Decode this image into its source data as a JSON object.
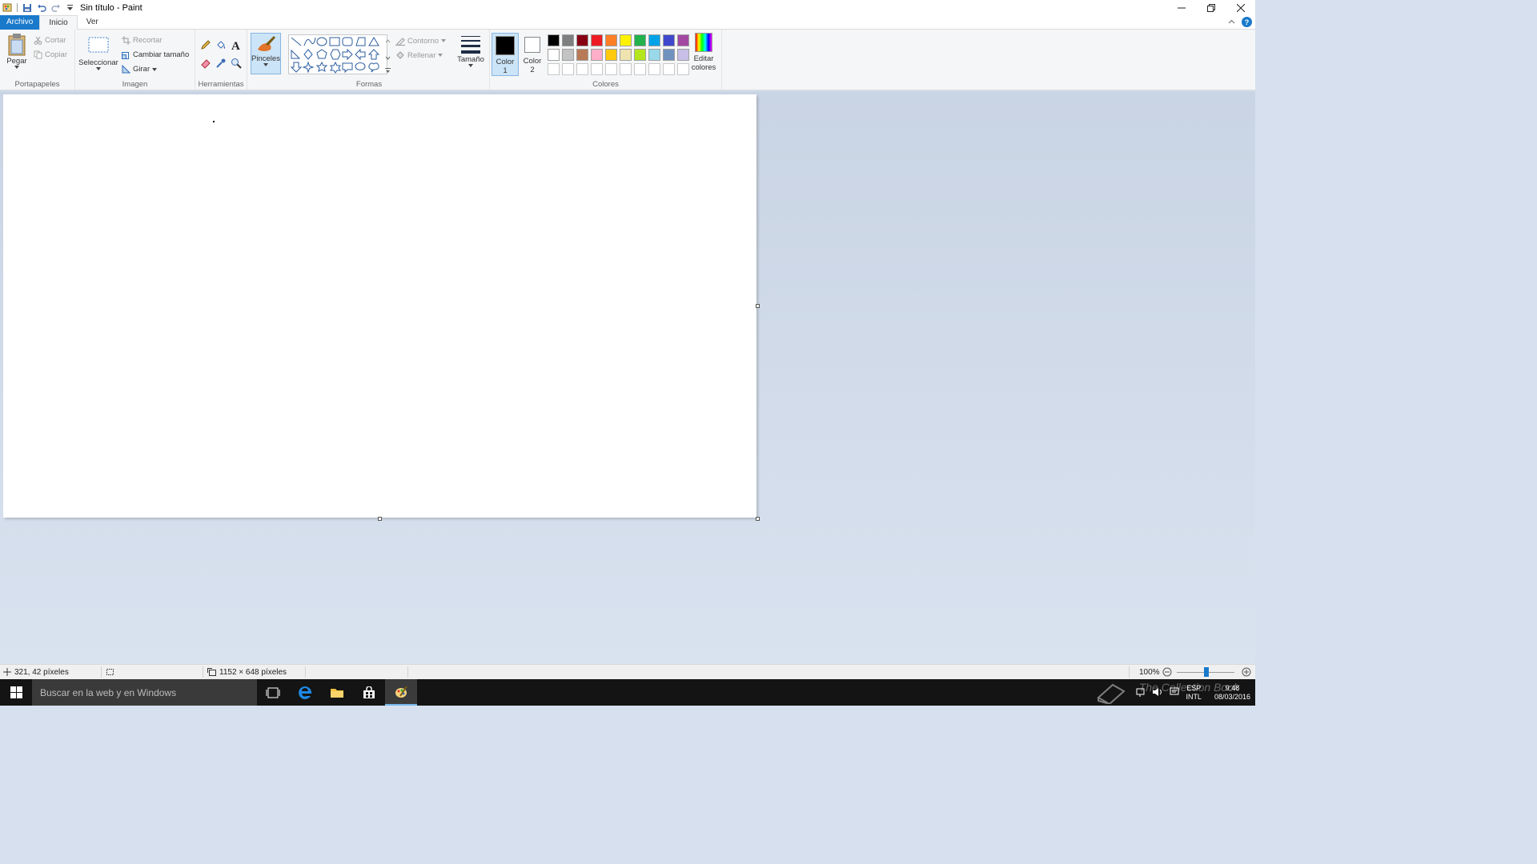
{
  "window": {
    "title": "Sin título - Paint"
  },
  "menu": {
    "file": "Archivo",
    "home": "Inicio",
    "view": "Ver"
  },
  "clipboard": {
    "paste": "Pegar",
    "cut": "Cortar",
    "copy": "Copiar",
    "label": "Portapapeles"
  },
  "image": {
    "select": "Seleccionar",
    "crop": "Recortar",
    "resize": "Cambiar tamaño",
    "rotate": "Girar",
    "label": "Imagen"
  },
  "tools": {
    "label": "Herramientas"
  },
  "brushes": {
    "label": "Pinceles"
  },
  "shapes": {
    "outline": "Contorno",
    "fill": "Rellenar",
    "label": "Formas"
  },
  "size": {
    "label": "Tamaño"
  },
  "colors": {
    "color1": "Color\n1",
    "color1_a": "Color",
    "color1_b": "1",
    "color2_a": "Color",
    "color2_b": "2",
    "edit_a": "Editar",
    "edit_b": "colores",
    "label": "Colores",
    "active_color1": "#000000",
    "active_color2": "#ffffff",
    "palette_row1": [
      "#000000",
      "#7f7f7f",
      "#880015",
      "#ed1c24",
      "#ff7f27",
      "#fff200",
      "#22b14c",
      "#00a2e8",
      "#3f48cc",
      "#a349a4"
    ],
    "palette_row2": [
      "#ffffff",
      "#c3c3c3",
      "#b97a57",
      "#ffaec9",
      "#ffc90e",
      "#efe4b0",
      "#b5e61d",
      "#99d9ea",
      "#7092be",
      "#c8bfe7"
    ]
  },
  "status": {
    "cursor_pos": "321, 42 píxeles",
    "image_size": "1152 × 648 píxeles",
    "zoom": "100%"
  },
  "taskbar": {
    "search_placeholder": "Buscar en la web y en Windows",
    "lang1": "ESP",
    "lang2": "INTL",
    "time": "9:48",
    "date": "08/03/2016"
  },
  "watermark": "The Collection Book"
}
